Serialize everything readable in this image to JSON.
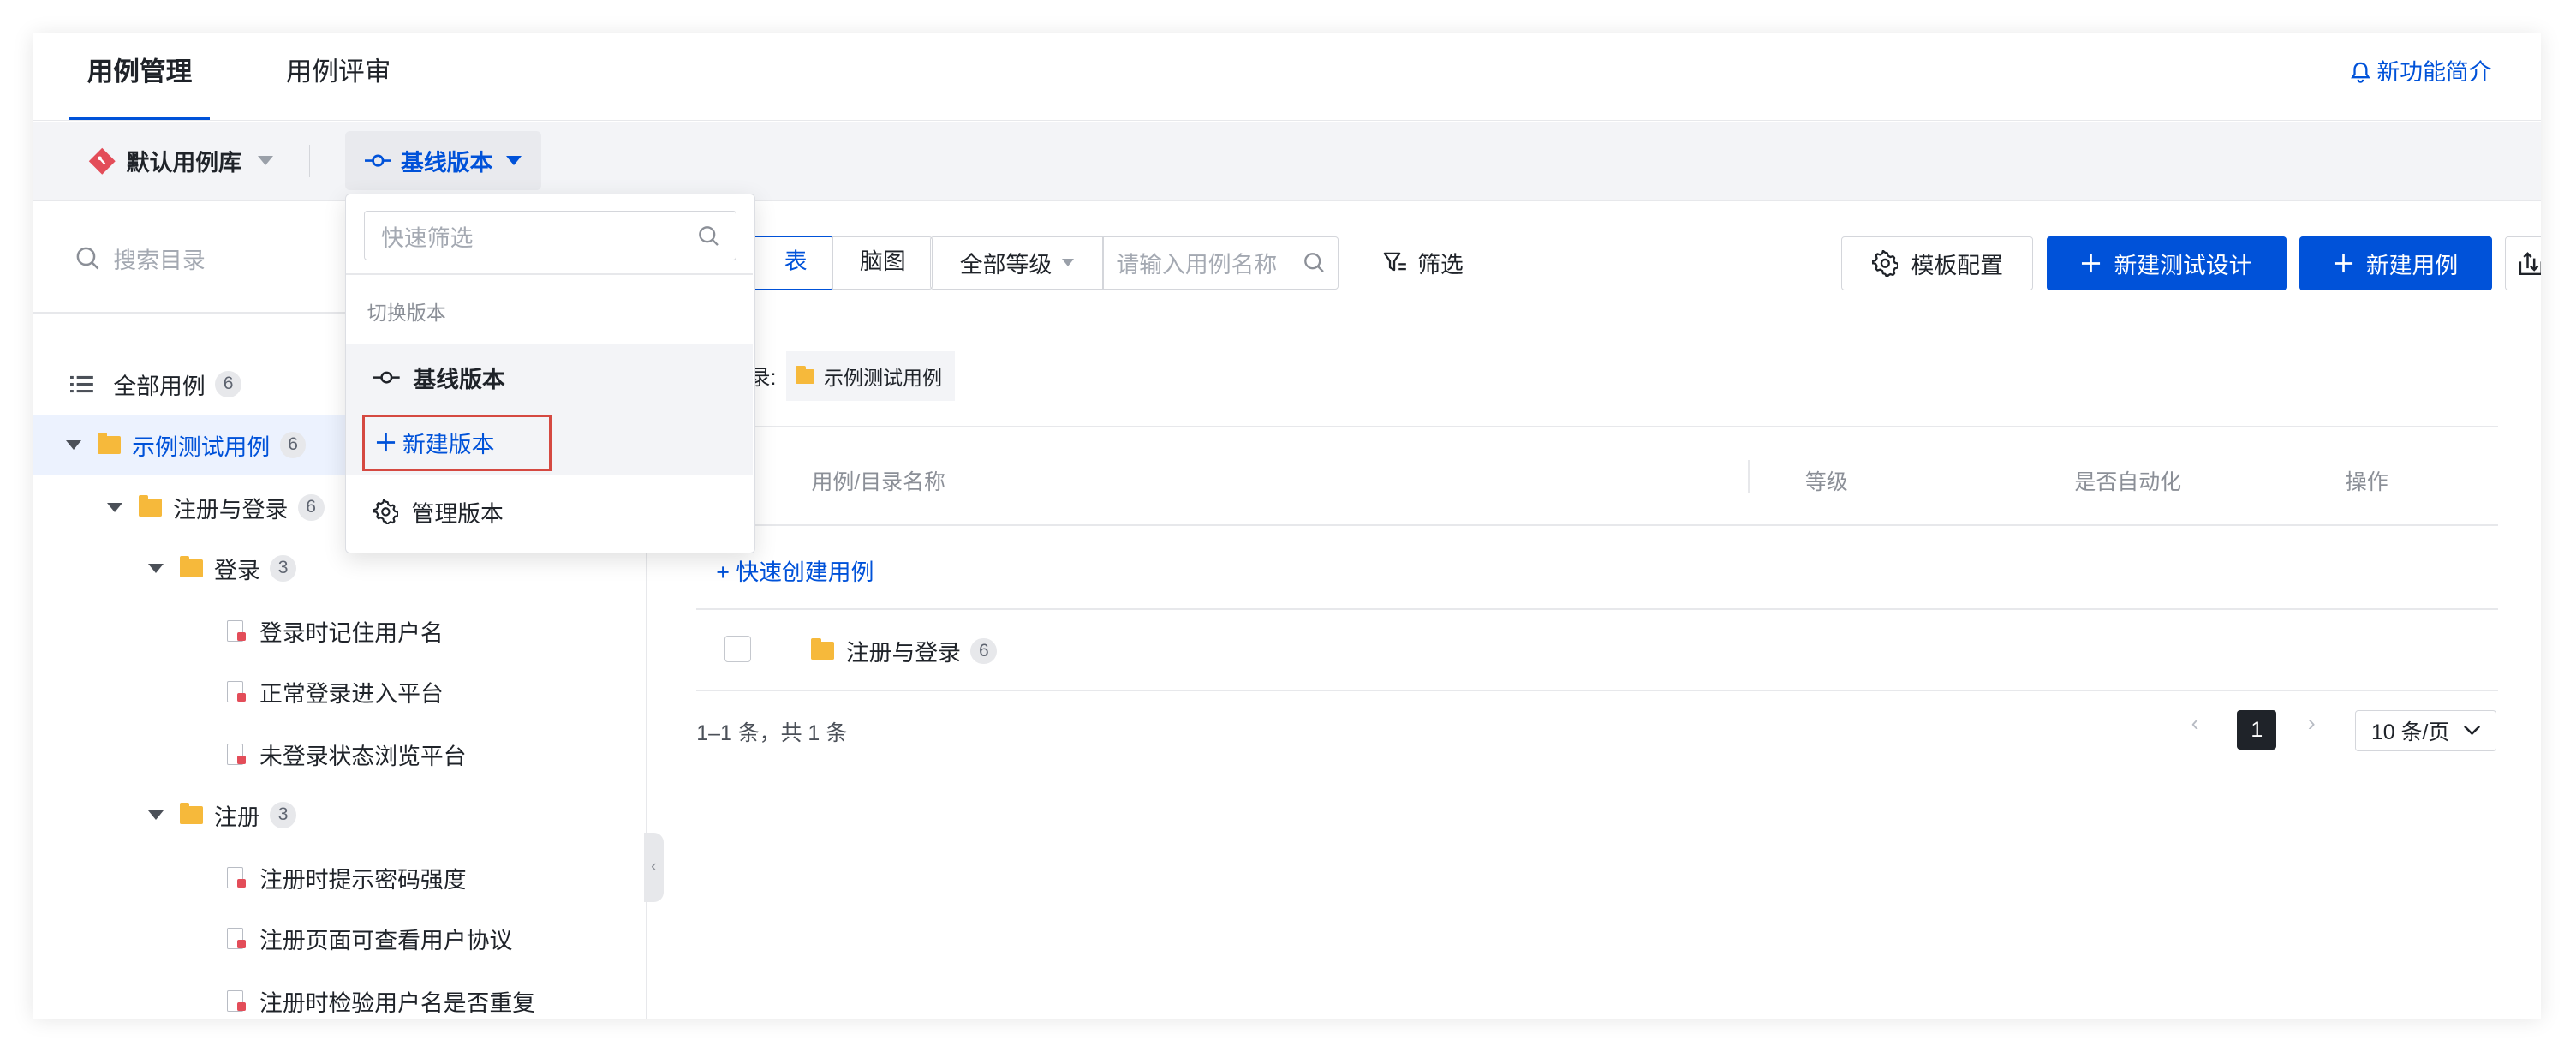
{
  "top_tabs": [
    {
      "label": "用例管理",
      "active": true
    },
    {
      "label": "用例评审",
      "active": false
    }
  ],
  "feature_intro": "新功能简介",
  "repo_selector": "默认用例库",
  "version_selector": "基线版本",
  "version_dropdown": {
    "search_placeholder": "快速筛选",
    "group_label": "切换版本",
    "current_version": "基线版本",
    "new_version": "新建版本",
    "manage_versions": "管理版本"
  },
  "sidebar": {
    "search_placeholder": "搜索目录",
    "all_cases": {
      "label": "全部用例",
      "count": "6"
    },
    "tree": [
      {
        "label": "示例测试用例",
        "count": "6",
        "type": "folder",
        "selected": true
      },
      {
        "label": "注册与登录",
        "count": "6",
        "type": "folder"
      },
      {
        "label": "登录",
        "count": "3",
        "type": "folder"
      },
      {
        "label": "登录时记住用户名",
        "type": "case"
      },
      {
        "label": "正常登录进入平台",
        "type": "case"
      },
      {
        "label": "未登录状态浏览平台",
        "type": "case"
      },
      {
        "label": "注册",
        "count": "3",
        "type": "folder"
      },
      {
        "label": "注册时提示密码强度",
        "type": "case"
      },
      {
        "label": "注册页面可查看用户协议",
        "type": "case"
      },
      {
        "label": "注册时检验用户名是否重复",
        "type": "case"
      }
    ]
  },
  "toolbar": {
    "view_list": "表",
    "view_mindmap": "脑图",
    "level_filter": "全部等级",
    "name_placeholder": "请输入用例名称",
    "filter": "筛选",
    "template_config": "模板配置",
    "new_test_design": "新建测试设计",
    "new_case": "新建用例"
  },
  "content": {
    "breadcrumb_label": "目录:",
    "breadcrumb_chip": "示例测试用例",
    "columns": [
      "用例/目录名称",
      "等级",
      "是否自动化",
      "操作"
    ],
    "quick_create": "+ 快速创建用例",
    "rows": [
      {
        "name": "注册与登录",
        "count": "6"
      }
    ]
  },
  "pagination": {
    "total": "1–1 条，共 1 条",
    "current_page": "1",
    "page_size": "10 条/页"
  },
  "colors": {
    "brand": "#0052d9",
    "highlight_box": "#d54941",
    "folder": "#f6b93b"
  }
}
